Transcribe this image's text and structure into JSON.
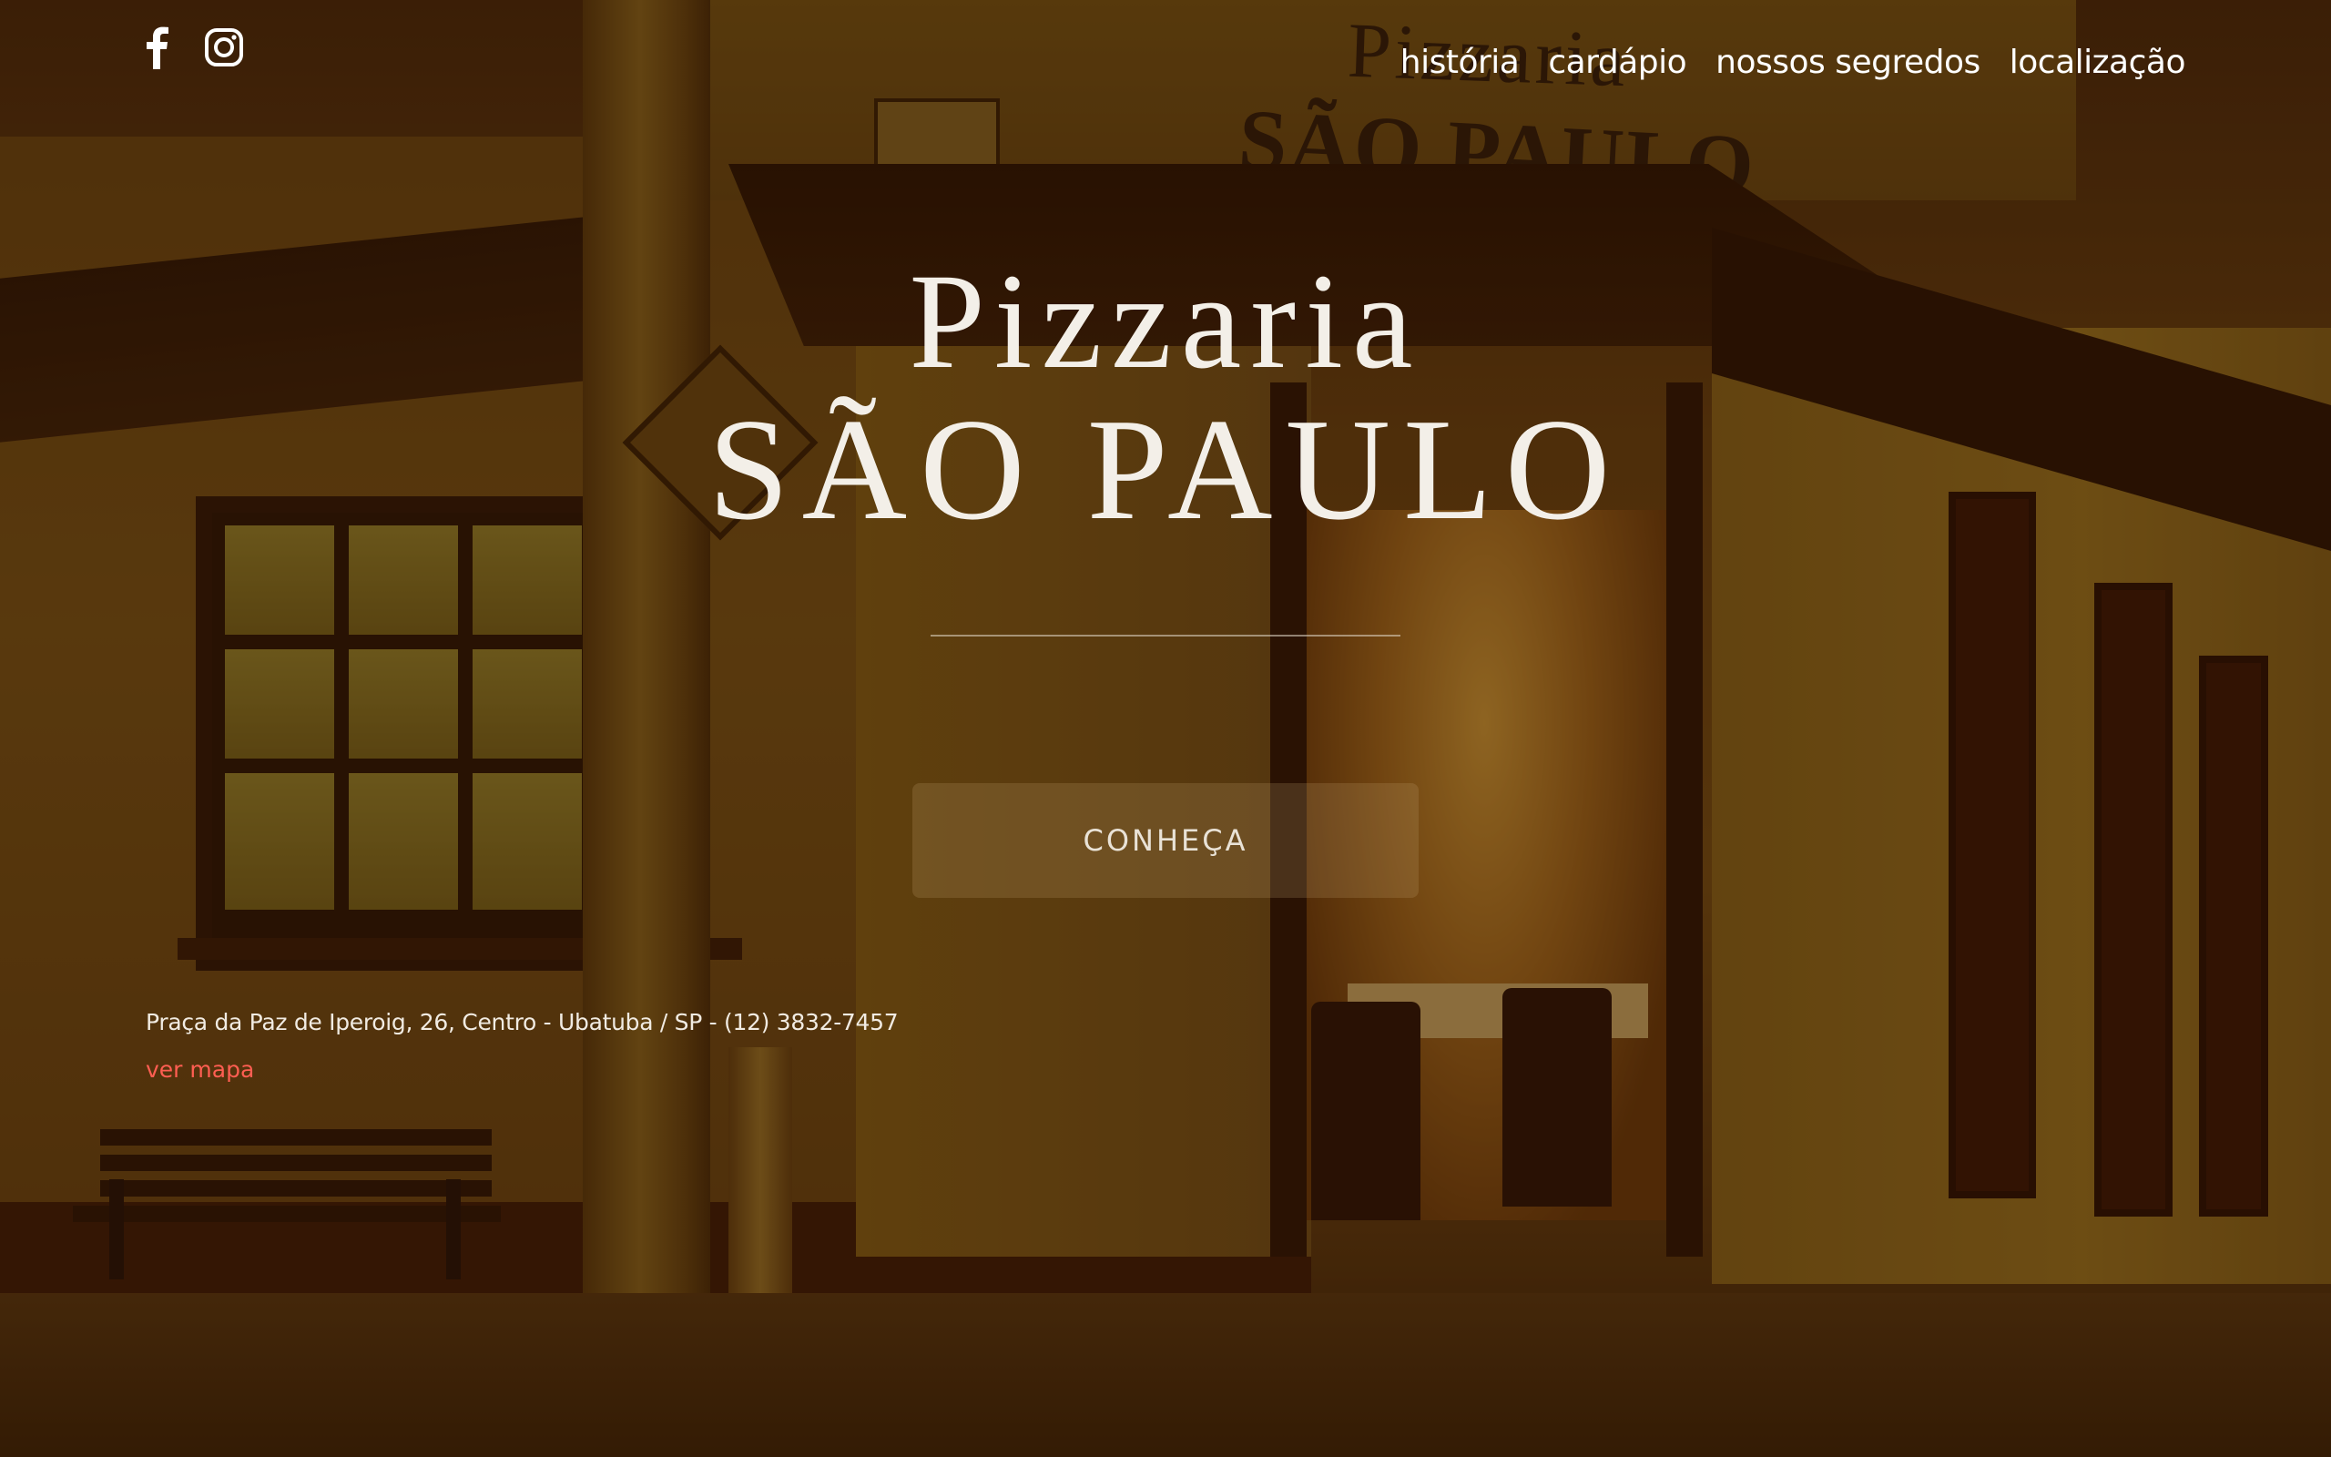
{
  "social": {
    "icons": [
      "facebook-icon",
      "instagram-icon"
    ]
  },
  "nav": {
    "items": [
      {
        "label": "história"
      },
      {
        "label": "cardápio"
      },
      {
        "label": "nossos segredos"
      },
      {
        "label": "localização"
      }
    ]
  },
  "hero": {
    "title_line1": "Pizzaria",
    "title_line2": "SÃO PAULO",
    "cta_label": "CONHEÇA"
  },
  "contact": {
    "address": "Praça da Paz de Iperoig, 26, Centro - Ubatuba / SP - (12) 3832-7457",
    "map_link": "ver mapa"
  },
  "background_sign": {
    "line1": "Pizzaria",
    "line2": "SÃO PAULO"
  },
  "colors": {
    "link_accent": "#ff5e52",
    "text_light": "#f3efe8",
    "overlay_tint": "#260e00"
  }
}
